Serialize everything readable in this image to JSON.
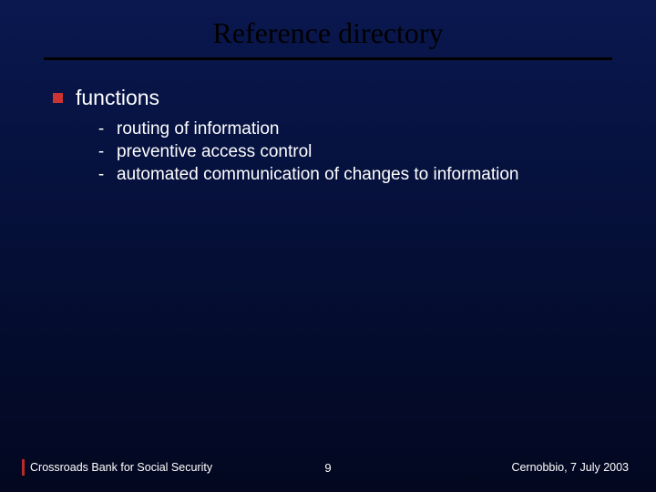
{
  "title": "Reference directory",
  "bullets": [
    {
      "label": "functions",
      "subitems": [
        "routing of information",
        "preventive access control",
        "automated communication of changes to information"
      ]
    }
  ],
  "footer": {
    "left": "Crossroads Bank for Social Security",
    "page": "9",
    "right": "Cernobbio, 7 July 2003"
  }
}
